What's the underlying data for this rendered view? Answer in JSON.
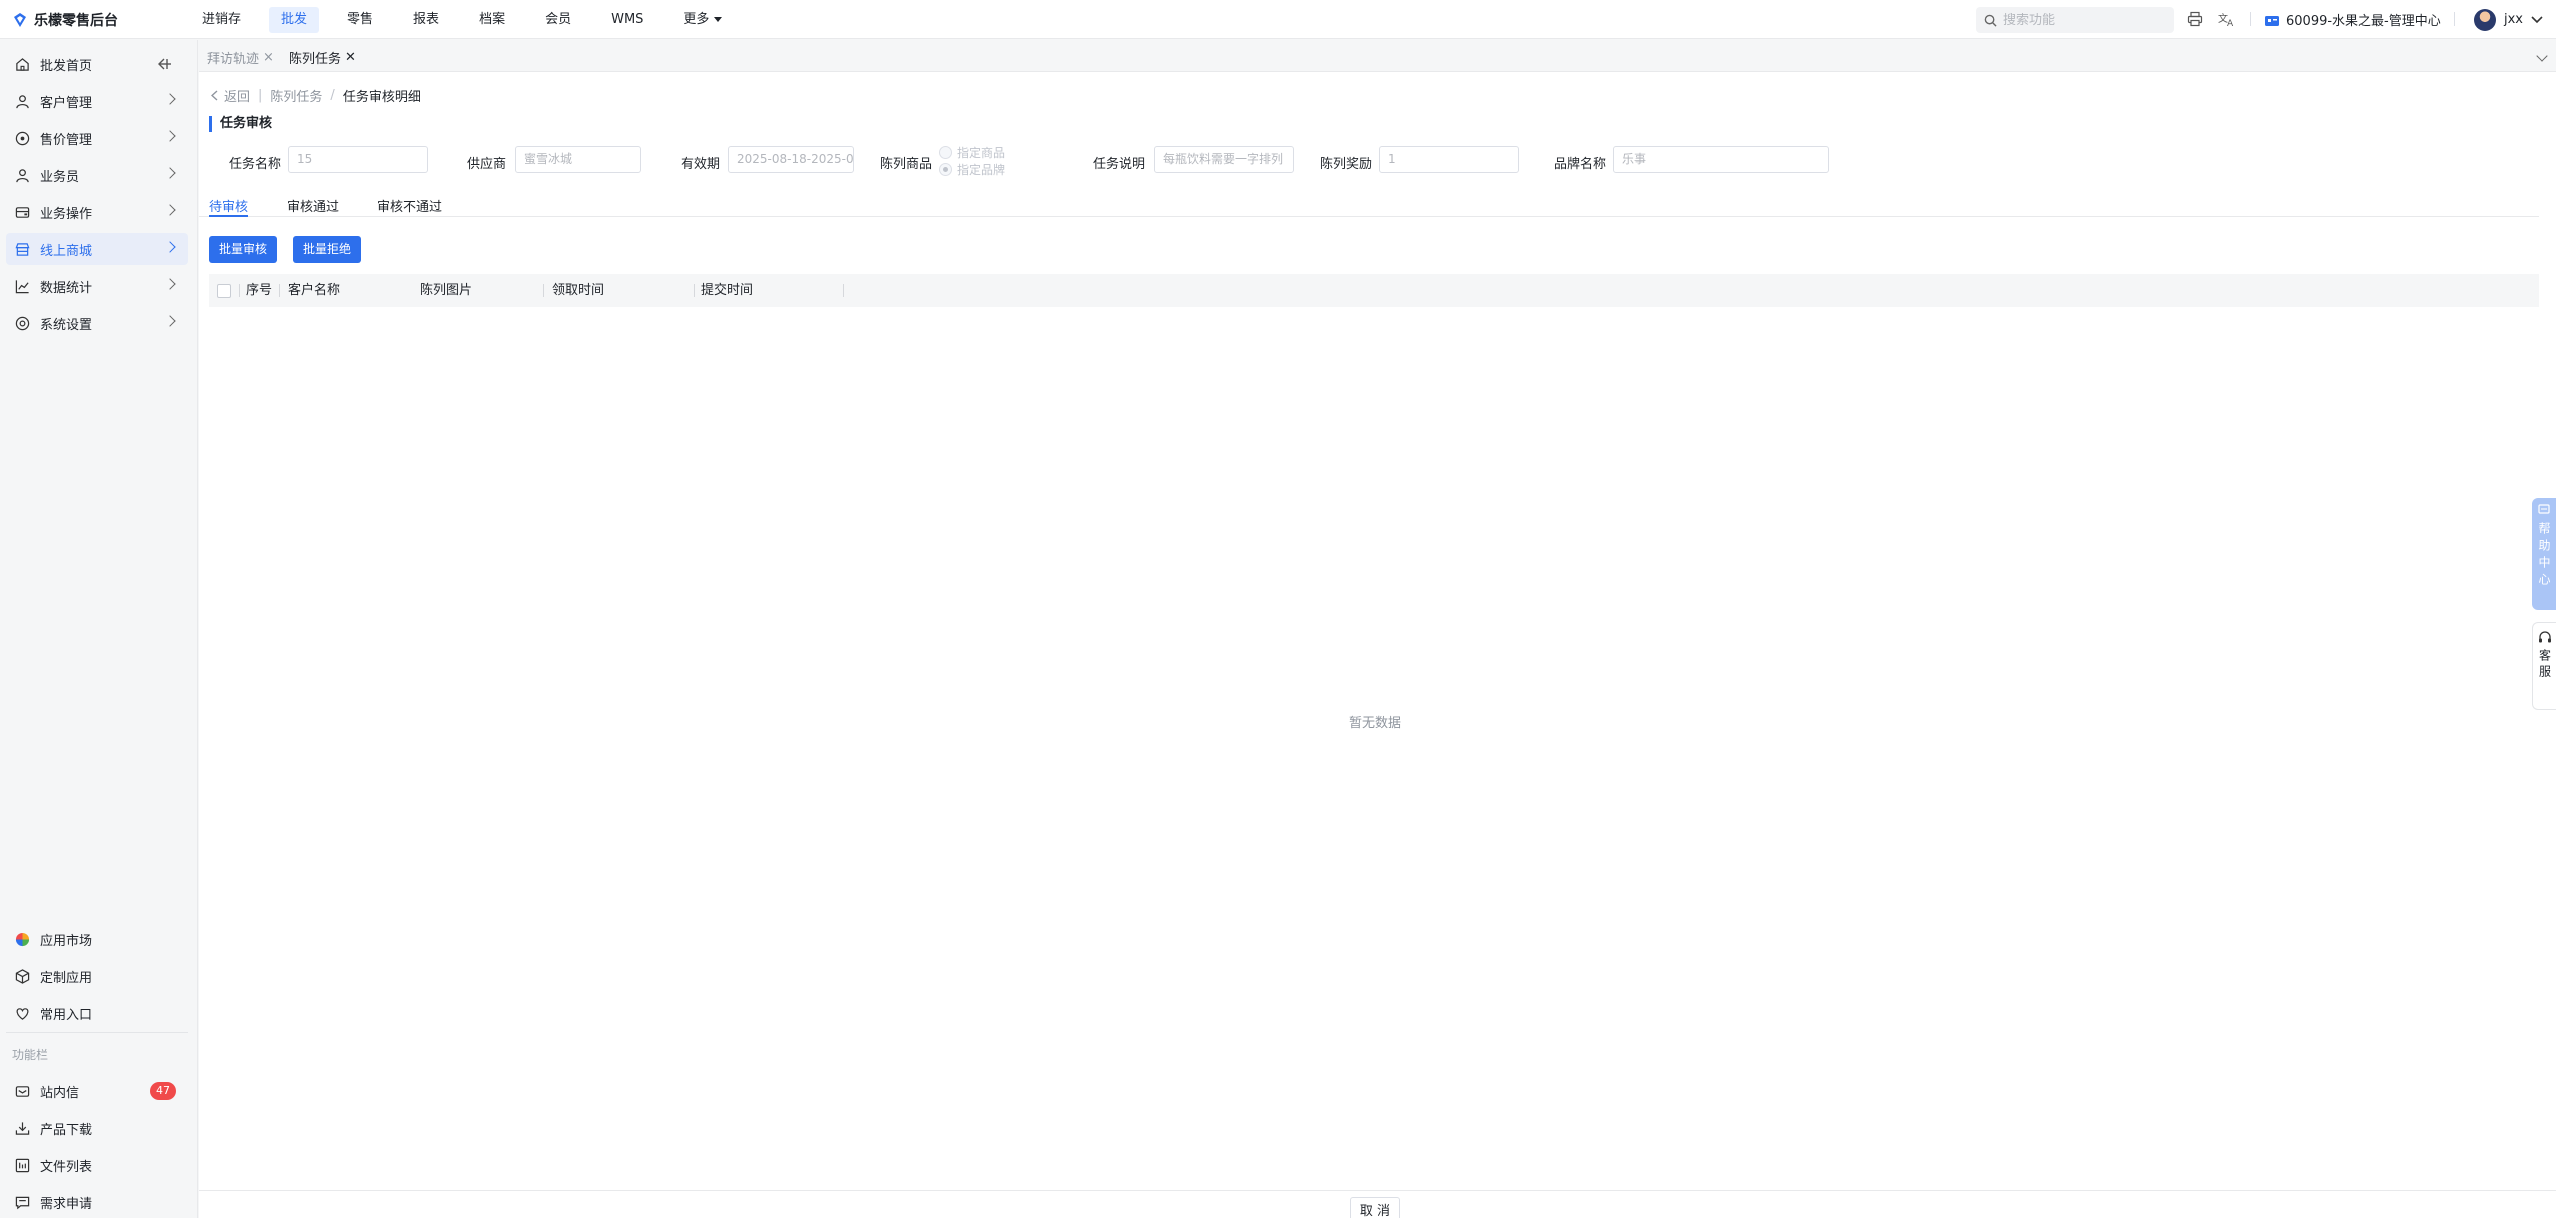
{
  "brand": {
    "name": "乐檬零售后台"
  },
  "topnav": [
    {
      "label": "进销存",
      "active": false
    },
    {
      "label": "批发",
      "active": true
    },
    {
      "label": "零售",
      "active": false
    },
    {
      "label": "报表",
      "active": false
    },
    {
      "label": "档案",
      "active": false
    },
    {
      "label": "会员",
      "active": false
    },
    {
      "label": "WMS",
      "active": false
    },
    {
      "label": "更多",
      "active": false
    }
  ],
  "search": {
    "placeholder": "搜索功能"
  },
  "store": {
    "label": "60099-水果之最-管理中心"
  },
  "user": {
    "name": "jxx"
  },
  "sidebar": {
    "items": [
      {
        "label": "批发首页",
        "icon": "home-icon"
      },
      {
        "label": "客户管理",
        "icon": "user-icon"
      },
      {
        "label": "售价管理",
        "icon": "price-icon"
      },
      {
        "label": "业务员",
        "icon": "person-icon"
      },
      {
        "label": "业务操作",
        "icon": "wallet-icon"
      },
      {
        "label": "线上商城",
        "icon": "store-icon",
        "active": true
      },
      {
        "label": "数据统计",
        "icon": "chart-icon"
      },
      {
        "label": "系统设置",
        "icon": "settings-icon"
      }
    ],
    "bottom": [
      {
        "label": "应用市场",
        "icon": "app-market-icon"
      },
      {
        "label": "定制应用",
        "icon": "cube-icon"
      },
      {
        "label": "常用入口",
        "icon": "heart-icon"
      }
    ],
    "caption": "功能栏",
    "tools": [
      {
        "label": "站内信",
        "icon": "mail-icon",
        "badge": "47"
      },
      {
        "label": "产品下载",
        "icon": "download-icon"
      },
      {
        "label": "文件列表",
        "icon": "file-list-icon"
      },
      {
        "label": "需求申请",
        "icon": "request-icon"
      }
    ]
  },
  "page_tabs": [
    {
      "label": "拜访轨迹",
      "active": false
    },
    {
      "label": "陈列任务",
      "active": true
    }
  ],
  "breadcrumb": {
    "back": "返回",
    "parent": "陈列任务",
    "current": "任务审核明细"
  },
  "section_title": "任务审核",
  "form": {
    "task_name": {
      "label": "任务名称",
      "value": "15"
    },
    "supplier": {
      "label": "供应商",
      "value": "蜜雪冰城"
    },
    "validity": {
      "label": "有效期",
      "value": "2025-08-18-2025-0"
    },
    "display_goods": {
      "label": "陈列商品",
      "option1": "指定商品",
      "option2": "指定品牌",
      "selected": "指定品牌"
    },
    "task_desc": {
      "label": "任务说明",
      "value": "每瓶饮料需要一字排列"
    },
    "reward": {
      "label": "陈列奖励",
      "value": "1"
    },
    "brand_name": {
      "label": "品牌名称",
      "value": "乐事"
    }
  },
  "review_tabs": [
    {
      "label": "待审核",
      "active": true
    },
    {
      "label": "审核通过",
      "active": false
    },
    {
      "label": "审核不通过",
      "active": false
    }
  ],
  "actions": {
    "batch_approve": "批量审核",
    "batch_reject": "批量拒绝"
  },
  "table": {
    "columns": [
      "序号",
      "客户名称",
      "陈列图片",
      "领取时间",
      "提交时间"
    ],
    "rows": [],
    "empty_text": "暂无数据"
  },
  "footer": {
    "cancel": "取 消"
  },
  "float": {
    "help": "帮助中心",
    "service": "客服"
  },
  "colors": {
    "accent": "#2d6fec",
    "badge": "#f04a4a"
  }
}
